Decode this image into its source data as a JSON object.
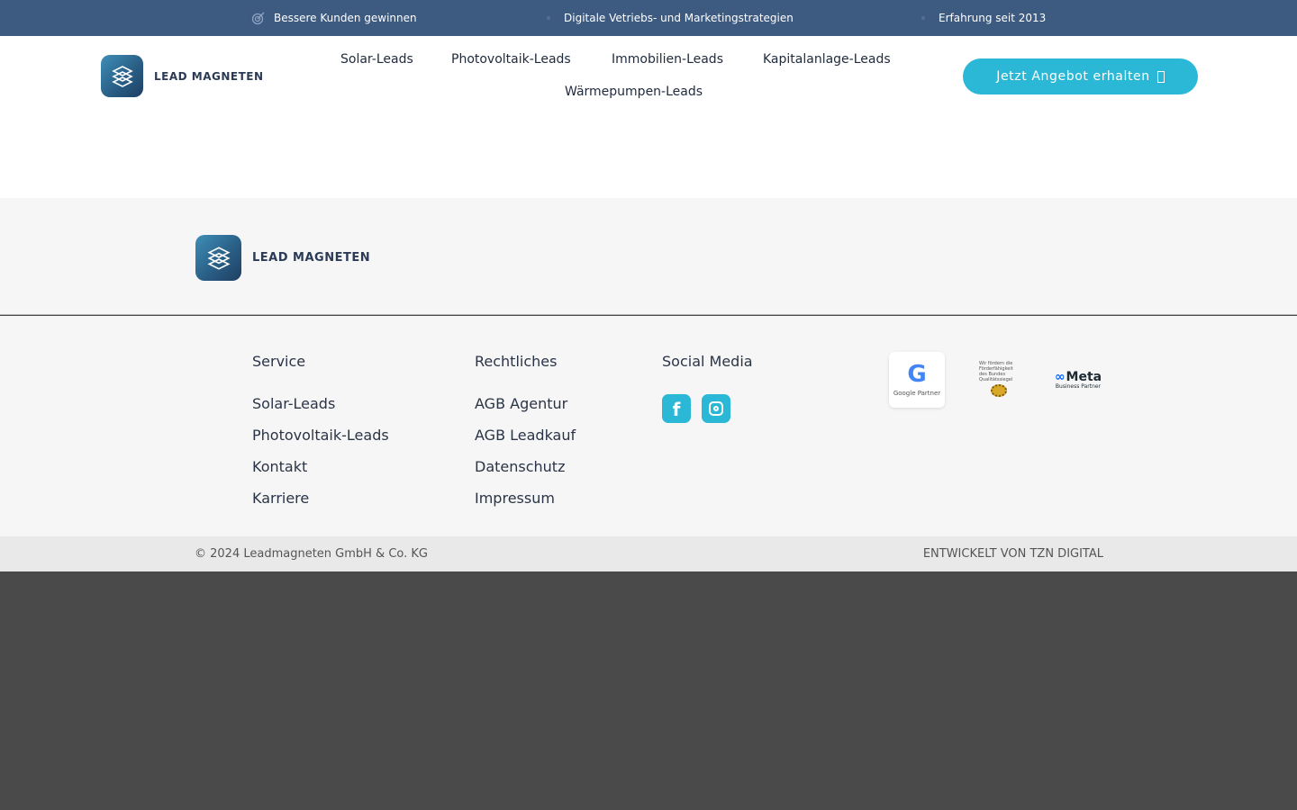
{
  "topbar": {
    "items": [
      {
        "icon": "target-icon",
        "label": "Bessere Kunden gewinnen"
      },
      {
        "icon": "strategy-icon",
        "label": "Digitale Vetriebs- und Marketingstrategien"
      },
      {
        "icon": "award-icon",
        "label": "Erfahrung seit 2013"
      }
    ]
  },
  "brand": {
    "name": "LEAD MAGNETEN",
    "accent_color": "#2ab8d6",
    "topbar_color": "#3d5a80"
  },
  "nav": {
    "items": [
      "Solar-Leads",
      "Photovoltaik-Leads",
      "Immobilien-Leads",
      "Kapitalanlage-Leads",
      "Wärmepumpen-Leads"
    ],
    "cta_label": "Jetzt Angebot erhalten"
  },
  "footer": {
    "columns": [
      {
        "title": "Service",
        "links": [
          "Solar-Leads",
          "Photovoltaik-Leads",
          "Kontakt",
          "Karriere"
        ]
      },
      {
        "title": "Rechtliches",
        "links": [
          "AGB Agentur",
          "AGB Leadkauf",
          "Datenschutz",
          "Impressum"
        ]
      },
      {
        "title": "Social Media",
        "social": [
          "facebook-icon",
          "instagram-icon"
        ]
      }
    ],
    "badges": {
      "google": {
        "letter": "G",
        "sub": "Google Partner"
      },
      "seal": {
        "text": "Wir fördern die Förderfähigkeit des Bundes Qualitätssiegel"
      },
      "meta": {
        "mark": "∞",
        "word": "Meta",
        "sub": "Business Partner"
      }
    },
    "copyright": "© 2024 Leadmagneten GmbH & Co. KG",
    "credit": "ENTWICKELT VON TZN DIGITAL"
  }
}
